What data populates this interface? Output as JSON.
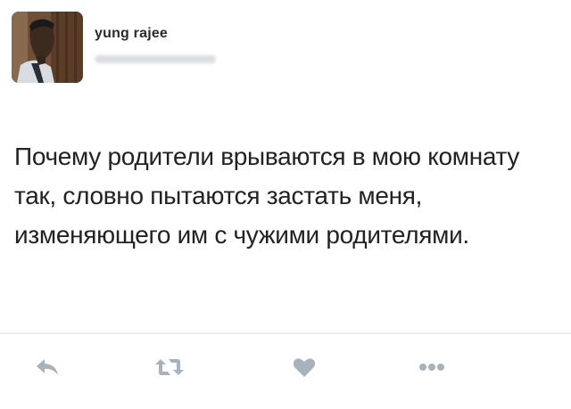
{
  "tweet": {
    "author": {
      "display_name": "yung rajee"
    },
    "text": "Почему родители врываются в мою комнату так, словно пытаются застать меня, изменяющего им с чужими родителями.",
    "actions": {
      "reply_icon": "reply-arrow-icon",
      "retweet_icon": "retweet-icon",
      "like_icon": "heart-icon",
      "more_icon": "more-dots-icon"
    },
    "colors": {
      "icon": "#a8b2bd",
      "text": "#222222",
      "divider": "#eef0f2"
    }
  }
}
